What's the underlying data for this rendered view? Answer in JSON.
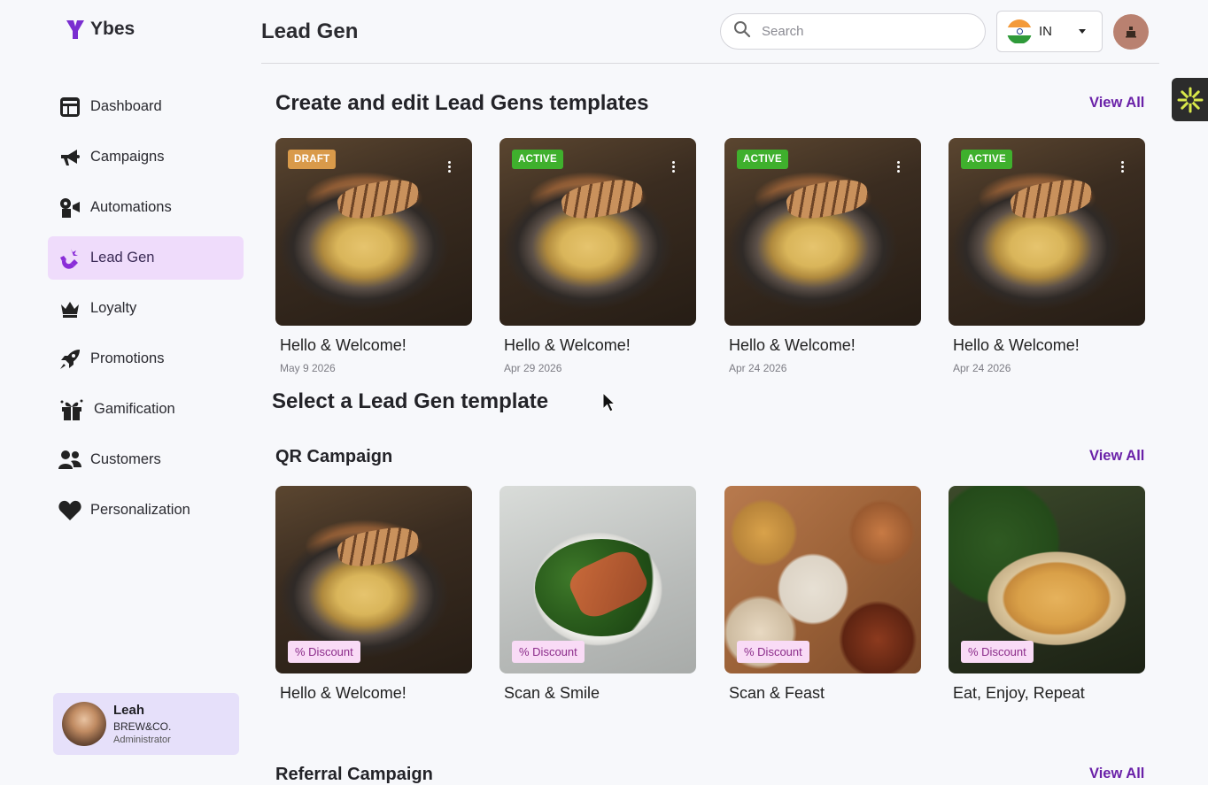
{
  "app": {
    "name": "Ybes"
  },
  "header": {
    "title": "Lead Gen",
    "search_placeholder": "Search",
    "country_code": "IN"
  },
  "sidebar": {
    "items": [
      {
        "label": "Dashboard",
        "icon": "dashboard-icon",
        "active": false
      },
      {
        "label": "Campaigns",
        "icon": "megaphone-icon",
        "active": false
      },
      {
        "label": "Automations",
        "icon": "automation-icon",
        "active": false
      },
      {
        "label": "Lead Gen",
        "icon": "magnet-icon",
        "active": true
      },
      {
        "label": "Loyalty",
        "icon": "crown-icon",
        "active": false
      },
      {
        "label": "Promotions",
        "icon": "rocket-icon",
        "active": false
      },
      {
        "label": "Gamification",
        "icon": "gift-icon",
        "active": false
      },
      {
        "label": "Customers",
        "icon": "users-icon",
        "active": false
      },
      {
        "label": "Personalization",
        "icon": "heart-icon",
        "active": false
      }
    ],
    "user": {
      "name": "Leah",
      "org": "BREW&CO.",
      "role": "Administrator"
    }
  },
  "sections": {
    "templates": {
      "title": "Create and edit Lead Gens templates",
      "view_all": "View All",
      "cards": [
        {
          "status": "DRAFT",
          "title": "Hello & Welcome!",
          "date": "May 9 2026"
        },
        {
          "status": "ACTIVE",
          "title": "Hello & Welcome!",
          "date": "Apr 29 2026"
        },
        {
          "status": "ACTIVE",
          "title": "Hello & Welcome!",
          "date": "Apr 24 2026"
        },
        {
          "status": "ACTIVE",
          "title": "Hello & Welcome!",
          "date": "Apr 24 2026"
        }
      ]
    },
    "select_title": "Select a Lead Gen template",
    "qr": {
      "title": "QR Campaign",
      "view_all": "View All",
      "cards": [
        {
          "tag": "% Discount",
          "title": "Hello & Welcome!"
        },
        {
          "tag": "% Discount",
          "title": "Scan & Smile"
        },
        {
          "tag": "% Discount",
          "title": "Scan & Feast"
        },
        {
          "tag": "% Discount",
          "title": "Eat, Enjoy, Repeat"
        }
      ]
    },
    "referral": {
      "title": "Referral Campaign",
      "view_all": "View All"
    }
  },
  "colors": {
    "accent": "#6a21a8",
    "active_nav_bg": "#efdcfb",
    "draft_badge": "#d99a4a",
    "active_badge": "#3fb02d",
    "discount_tag_bg": "#f9dbf6"
  }
}
